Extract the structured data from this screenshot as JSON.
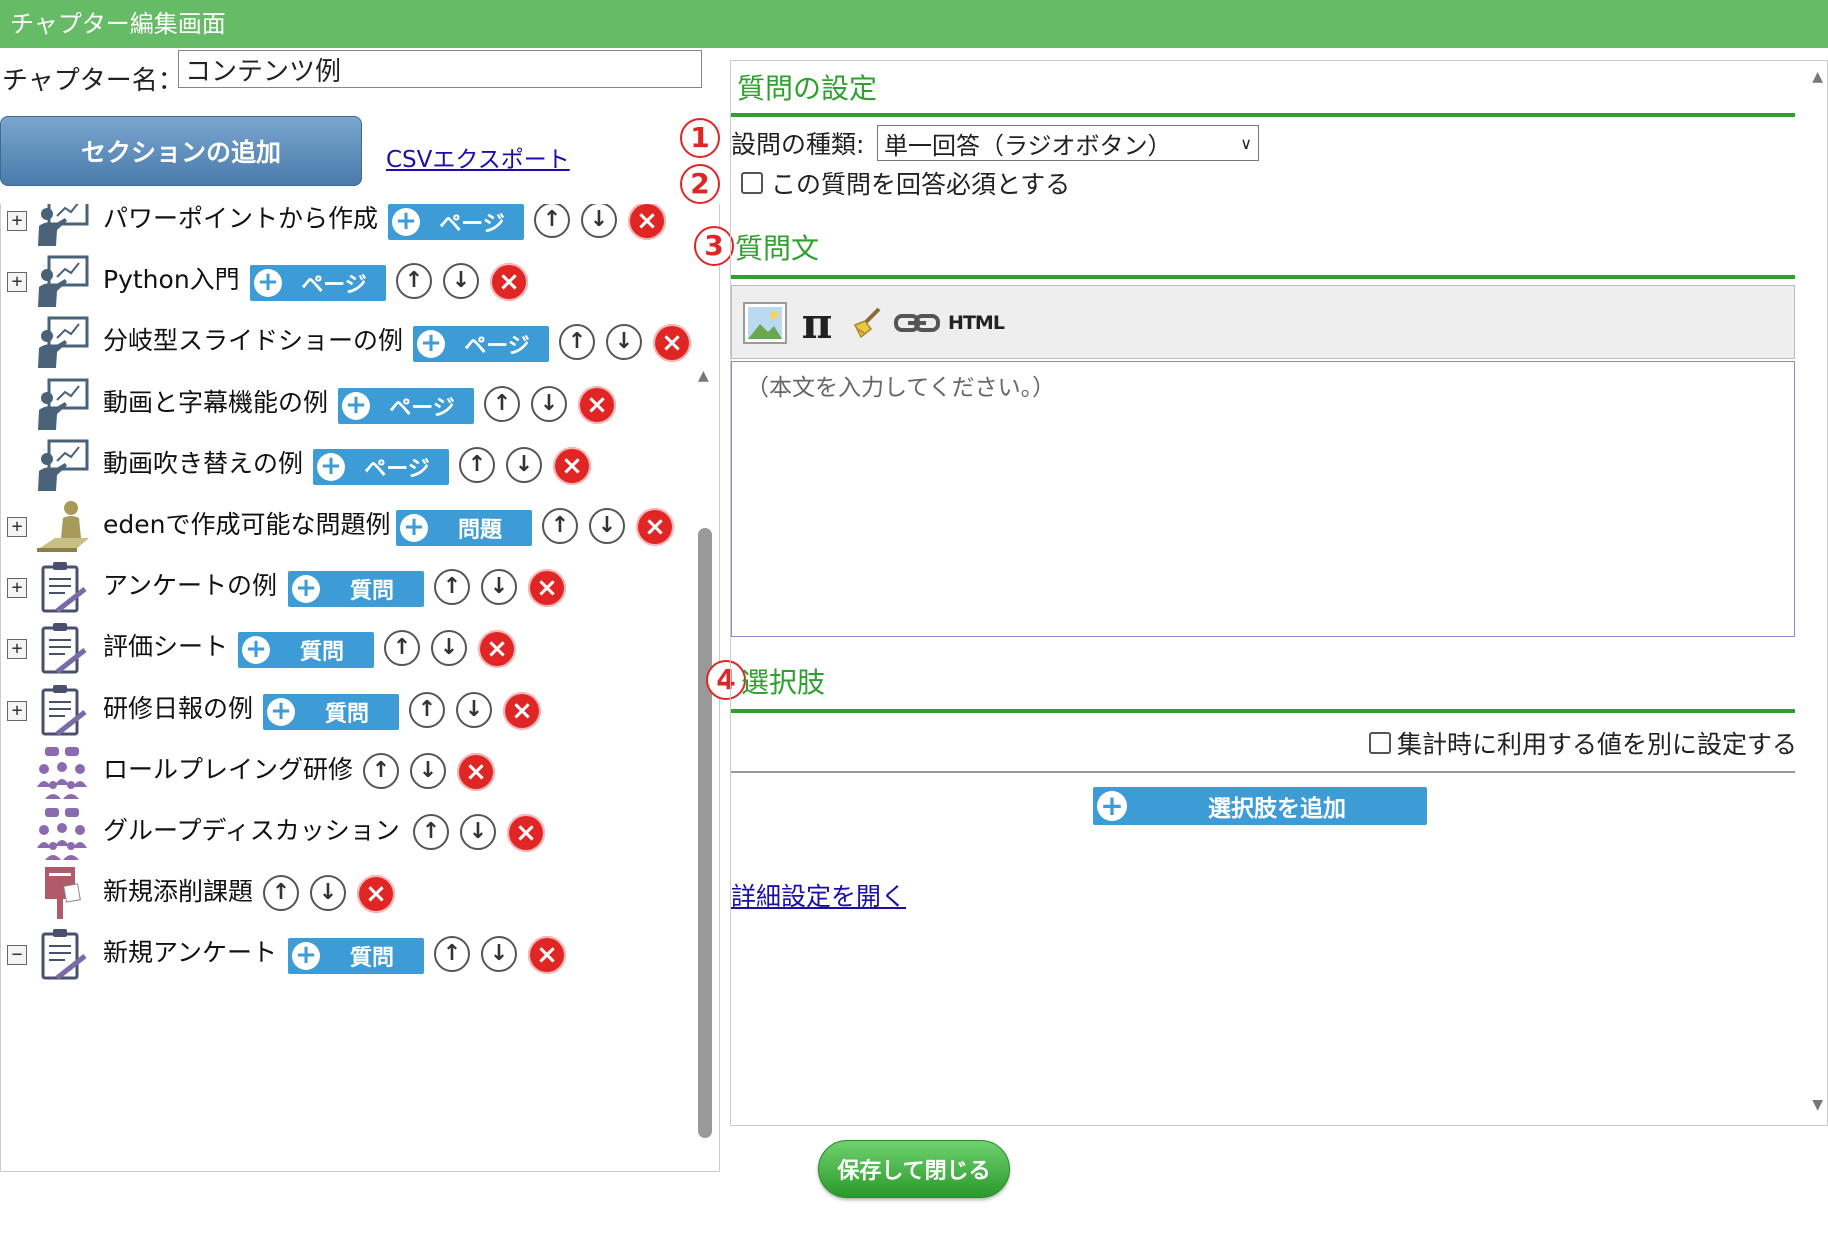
{
  "window": {
    "title": "チャプター編集画面"
  },
  "chapter": {
    "name_label": "チャプター名：",
    "name_value": "コンテンツ例"
  },
  "toolbar": {
    "add_section_label": "セクションの追加",
    "csv_export_label": "CSVエクスポート"
  },
  "tree": {
    "items": [
      {
        "label": "パワーポイントから作成",
        "expander": "+",
        "icon": "presenter-icon",
        "tag": "ページ"
      },
      {
        "label": "Python入門",
        "expander": "+",
        "icon": "presenter-icon",
        "tag": "ページ"
      },
      {
        "label": "分岐型スライドショーの例",
        "expander": "",
        "icon": "presenter-icon",
        "tag": "ページ"
      },
      {
        "label": "動画と字幕機能の例",
        "expander": "",
        "icon": "presenter-icon",
        "tag": "ページ"
      },
      {
        "label": "動画吹き替えの例",
        "expander": "",
        "icon": "presenter-icon",
        "tag": "ページ"
      },
      {
        "label": "edenで作成可能な問題例",
        "expander": "+",
        "icon": "exam-person-icon",
        "tag": "問題"
      },
      {
        "label": "アンケートの例",
        "expander": "+",
        "icon": "clipboard-icon",
        "tag": "質問"
      },
      {
        "label": "評価シート",
        "expander": "+",
        "icon": "clipboard-icon",
        "tag": "質問"
      },
      {
        "label": "研修日報の例",
        "expander": "+",
        "icon": "clipboard-icon",
        "tag": "質問"
      },
      {
        "label": "ロールプレイング研修",
        "expander": "",
        "icon": "group-chat-icon",
        "tag": ""
      },
      {
        "label": "グループディスカッション",
        "expander": "",
        "icon": "group-chat-icon",
        "tag": ""
      },
      {
        "label": "新規添削課題",
        "expander": "",
        "icon": "post-box-icon",
        "tag": ""
      },
      {
        "label": "新規アンケート",
        "expander": "−",
        "icon": "clipboard-icon",
        "tag": "質問"
      }
    ]
  },
  "question": {
    "settings_heading": "質問の設定",
    "type_label": "設問の種類:",
    "type_value": "単一回答（ラジオボタン）",
    "required_label": "この質問を回答必須とする",
    "text_heading": "質問文",
    "editor_placeholder": "（本文を入力してください。）",
    "choices_heading": "選択肢",
    "aggregate_label": "集計時に利用する値を別に設定する",
    "add_choice_label": "選択肢を追加",
    "advanced_link": "詳細設定を開く"
  },
  "markers": {
    "m1": "1",
    "m2": "2",
    "m3": "3",
    "m4": "4"
  },
  "editor_toolbar": {
    "html_label": "HTML",
    "pi_label": "π"
  },
  "footer": {
    "save_close_label": "保存して閉じる"
  },
  "colors": {
    "titlebar": "#66bb66",
    "accent_green": "#2ea02e",
    "tag_blue": "#3d9bd6",
    "delete_red": "#e02525",
    "link": "#1a0dab"
  }
}
